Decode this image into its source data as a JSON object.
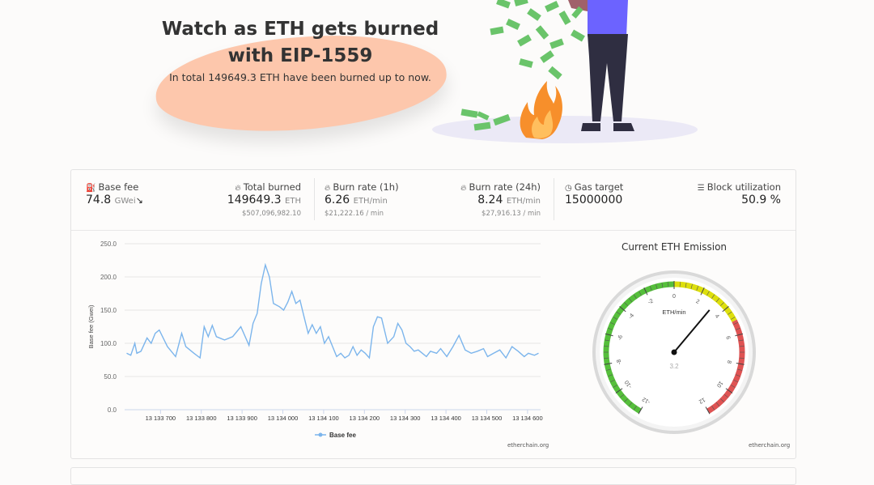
{
  "hero": {
    "title_line1": "Watch as ETH gets burned",
    "title_line2": "with EIP-1559",
    "subtitle": "In total 149649.3 ETH have been burned up to now."
  },
  "stats": {
    "base_fee": {
      "label": "Base fee",
      "value": "74.8",
      "unit": "GWei",
      "icon": "gas-pump-icon",
      "trend_icon": "trend-down-icon"
    },
    "total_burned": {
      "label": "Total burned",
      "value": "149649.3",
      "unit": "ETH",
      "usd": "$507,096,982.10",
      "icon": "flame-icon"
    },
    "burn_rate_1h": {
      "label": "Burn rate (1h)",
      "value": "6.26",
      "unit": "ETH/min",
      "usd": "$21,222.16 / min",
      "icon": "flame-icon"
    },
    "burn_rate_24h": {
      "label": "Burn rate (24h)",
      "value": "8.24",
      "unit": "ETH/min",
      "usd": "$27,916.13 / min",
      "icon": "flame-icon"
    },
    "gas_target": {
      "label": "Gas target",
      "value": "15000000",
      "icon": "gauge-icon"
    },
    "block_utilization": {
      "label": "Block utilization",
      "value": "50.9 %",
      "icon": "database-icon"
    }
  },
  "chart_data": [
    {
      "type": "line",
      "title": "",
      "xlabel": "",
      "ylabel": "Base fee (Gwei)",
      "ylim": [
        0,
        250
      ],
      "y_ticks": [
        "0.0",
        "50.0",
        "100.0",
        "150.0",
        "200.0",
        "250.0"
      ],
      "x_tick_labels": [
        "13 133 700",
        "13 133 800",
        "13 133 900",
        "13 134 000",
        "13 134 100",
        "13 134 200",
        "13 134 300",
        "13 134 400",
        "13 134 500",
        "13 134 600"
      ],
      "x_ticks": [
        13133700,
        13133800,
        13133900,
        13134000,
        13134100,
        13134200,
        13134300,
        13134400,
        13134500,
        13134600
      ],
      "xlim": [
        13133612,
        13134632
      ],
      "legend": "bottom-center",
      "color": "#7cb5ec",
      "series": [
        {
          "name": "Base fee",
          "x": [
            13133617,
            13133627,
            13133637,
            13133642,
            13133652,
            13133667,
            13133677,
            13133687,
            13133697,
            13133717,
            13133737,
            13133752,
            13133762,
            13133782,
            13133797,
            13133807,
            13133817,
            13133827,
            13133837,
            13133857,
            13133877,
            13133897,
            13133917,
            13133927,
            13133937,
            13133947,
            13133957,
            13133967,
            13133977,
            13133992,
            13134002,
            13134012,
            13134022,
            13134032,
            13134042,
            13134052,
            13134062,
            13134072,
            13134082,
            13134092,
            13134102,
            13134112,
            13134122,
            13134132,
            13134142,
            13134152,
            13134162,
            13134172,
            13134182,
            13134192,
            13134202,
            13134212,
            13134222,
            13134232,
            13134242,
            13134257,
            13134272,
            13134282,
            13134292,
            13134302,
            13134312,
            13134322,
            13134332,
            13134342,
            13134352,
            13134362,
            13134377,
            13134387,
            13134402,
            13134417,
            13134432,
            13134447,
            13134462,
            13134477,
            13134492,
            13134502,
            13134517,
            13134532,
            13134547,
            13134562,
            13134577,
            13134592,
            13134602,
            13134617,
            13134627
          ],
          "values": [
            85,
            82,
            100,
            85,
            88,
            108,
            100,
            115,
            120,
            95,
            80,
            115,
            95,
            85,
            78,
            125,
            110,
            127,
            110,
            105,
            110,
            125,
            97,
            130,
            145,
            190,
            218,
            200,
            160,
            155,
            150,
            162,
            178,
            160,
            165,
            140,
            115,
            128,
            115,
            125,
            100,
            110,
            95,
            80,
            85,
            78,
            82,
            95,
            82,
            90,
            85,
            78,
            125,
            140,
            138,
            100,
            110,
            130,
            120,
            100,
            95,
            88,
            90,
            85,
            80,
            88,
            85,
            92,
            80,
            95,
            112,
            90,
            85,
            88,
            92,
            80,
            85,
            90,
            78,
            95,
            88,
            80,
            85,
            82,
            85
          ]
        }
      ]
    },
    {
      "type": "gauge",
      "title": "Current ETH Emission",
      "unit_label": "ETH/min",
      "value": 3.2,
      "value_label": "3.2",
      "range": [
        -12,
        12
      ],
      "tick_labels": [
        "-12",
        "-10",
        "-8",
        "-6",
        "-4",
        "-2",
        "0",
        "2",
        "4",
        "6",
        "8",
        "10",
        "12"
      ],
      "bands": [
        {
          "from": -12,
          "to": 0,
          "color": "#55bf3b"
        },
        {
          "from": 0,
          "to": 5,
          "color": "#dddf0d"
        },
        {
          "from": 5,
          "to": 12,
          "color": "#df5353"
        }
      ]
    }
  ],
  "credits": {
    "chart": "etherchain.org",
    "gauge": "etherchain.org"
  }
}
